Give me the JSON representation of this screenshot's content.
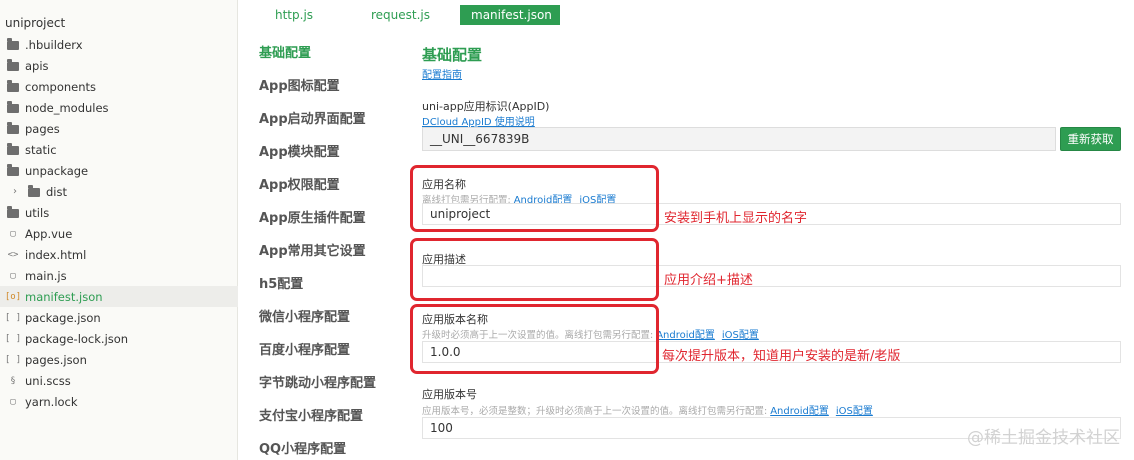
{
  "explorer": {
    "root": "uniproject",
    "items": [
      {
        "label": ".hbuilderx",
        "icon": "folder-icon"
      },
      {
        "label": "apis",
        "icon": "folder-icon"
      },
      {
        "label": "components",
        "icon": "folder-icon"
      },
      {
        "label": "node_modules",
        "icon": "folder-icon"
      },
      {
        "label": "pages",
        "icon": "folder-icon"
      },
      {
        "label": "static",
        "icon": "folder-icon"
      },
      {
        "label": "unpackage",
        "icon": "folder-icon"
      },
      {
        "label": "dist",
        "icon": "folder-icon"
      },
      {
        "label": "utils",
        "icon": "folder-icon"
      },
      {
        "label": "App.vue",
        "icon": "vue-file-icon"
      },
      {
        "label": "index.html",
        "icon": "html-file-icon"
      },
      {
        "label": "main.js",
        "icon": "js-file-icon"
      },
      {
        "label": "manifest.json",
        "icon": "json-file-icon"
      },
      {
        "label": "package.json",
        "icon": "json-file-icon"
      },
      {
        "label": "package-lock.json",
        "icon": "json-file-icon"
      },
      {
        "label": "pages.json",
        "icon": "json-file-icon"
      },
      {
        "label": "uni.scss",
        "icon": "scss-file-icon"
      },
      {
        "label": "yarn.lock",
        "icon": "file-icon"
      }
    ]
  },
  "tabs": [
    "http.js",
    "request.js",
    "manifest.json"
  ],
  "nav": [
    "基础配置",
    "App图标配置",
    "App启动界面配置",
    "App模块配置",
    "App权限配置",
    "App原生插件配置",
    "App常用其它设置",
    "h5配置",
    "微信小程序配置",
    "百度小程序配置",
    "字节跳动小程序配置",
    "支付宝小程序配置",
    "QQ小程序配置"
  ],
  "content": {
    "title": "基础配置",
    "guide_link": "配置指南",
    "appid": {
      "label": "uni-app应用标识(AppID)",
      "link": "DCloud AppID 使用说明",
      "value": "__UNI__667839B",
      "button": "重新获取"
    },
    "name": {
      "label": "应用名称",
      "hint": "离线打包需另行配置:",
      "android": "Android配置",
      "ios": "iOS配置",
      "value": "uniproject"
    },
    "desc": {
      "label": "应用描述",
      "value": ""
    },
    "version_name": {
      "label": "应用版本名称",
      "hint": "升级时必须高于上一次设置的值。离线打包需另行配置:",
      "android": "Android配置",
      "ios": "iOS配置",
      "value": "1.0.0"
    },
    "version_code": {
      "label": "应用版本号",
      "hint": "应用版本号，必须是整数；升级时必须高于上一次设置的值。离线打包需另行配置:",
      "android": "Android配置",
      "ios": "iOS配置",
      "value": "100"
    }
  },
  "annotations": {
    "name_note": "安装到手机上显示的名字",
    "desc_note": "应用介绍+描述",
    "version_note": "每次提升版本，知道用户安装的是新/老版"
  },
  "watermark": "@稀土掘金技术社区",
  "colors": {
    "accent": "#2e9d52",
    "link": "#1a7bd0",
    "annotation": "#e0262f"
  }
}
